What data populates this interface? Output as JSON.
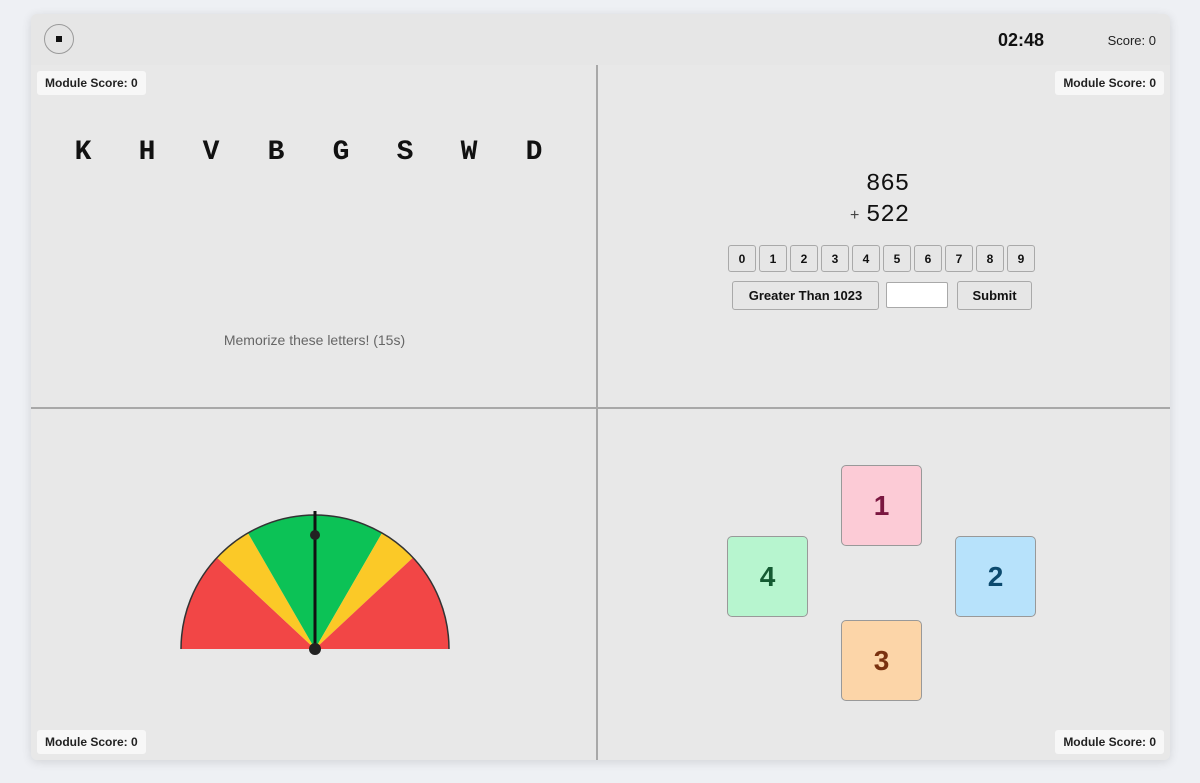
{
  "header": {
    "stop_icon": "stop-icon",
    "timer": "02:48",
    "score": "Score: 0"
  },
  "modules": {
    "memory": {
      "score": "Module Score: 0",
      "letters": [
        "K",
        "H",
        "V",
        "B",
        "G",
        "S",
        "W",
        "D"
      ],
      "instruction": "Memorize these letters! (15s)"
    },
    "math": {
      "score": "Module Score: 0",
      "operand1": "865",
      "operator": "+",
      "operand2": "522",
      "digit_buttons": [
        "0",
        "1",
        "2",
        "3",
        "4",
        "5",
        "6",
        "7",
        "8",
        "9"
      ],
      "compare_button": "Greater Than 1023",
      "answer_value": "",
      "submit_button": "Submit"
    },
    "gauge": {
      "score": "Module Score: 0",
      "needle_position": 0.5,
      "colors": {
        "red": "#f24646",
        "yellow": "#fbc927",
        "green": "#0cc256"
      }
    },
    "cards": {
      "score": "Module Score: 0",
      "items": [
        {
          "label": "1",
          "position": "top",
          "bg": "#fccbd6",
          "fg": "#7a1740"
        },
        {
          "label": "2",
          "position": "right",
          "bg": "#b7e2fb",
          "fg": "#0c4a6e"
        },
        {
          "label": "3",
          "position": "bottom",
          "bg": "#fcd5a8",
          "fg": "#7a3210"
        },
        {
          "label": "4",
          "position": "left",
          "bg": "#b7f5cf",
          "fg": "#145a32"
        }
      ]
    }
  }
}
